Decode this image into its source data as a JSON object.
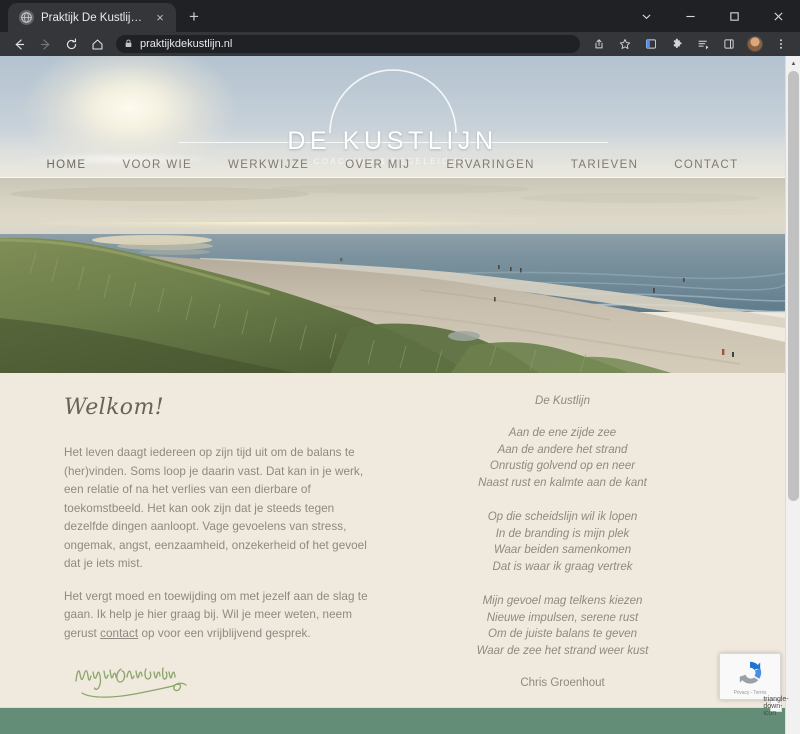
{
  "browser": {
    "tab": {
      "title": "Praktijk De Kustlijn - Home",
      "favicon_icon": "globe-icon",
      "close_icon": "×"
    },
    "new_tab_icon": "+",
    "window_controls": {
      "chevron_icon": "chevron-down-icon",
      "minimize_icon": "minimize-icon",
      "maximize_icon": "maximize-icon",
      "close_icon": "close-icon"
    },
    "toolbar": {
      "back_icon": "back-arrow-icon",
      "forward_icon": "forward-arrow-icon",
      "reload_icon": "reload-icon",
      "home_icon": "home-icon",
      "url": "praktijkdekustlijn.nl",
      "lock_icon": "lock-icon",
      "share_icon": "share-icon",
      "bookmark_icon": "star-icon",
      "sidepanel_icon": "side-panel-icon",
      "extensions_icon": "puzzle-icon",
      "reading_list_icon": "reading-list-icon",
      "split_icon": "split-view-icon",
      "profile_icon": "avatar-icon",
      "menu_icon": "three-dots-menu-icon"
    }
  },
  "site": {
    "logo": {
      "name": "DE KUSTLIJN",
      "subtitle": "COACHING & BEGELEIDING",
      "arc_icon": "arc-icon"
    },
    "nav": [
      {
        "label": "HOME",
        "active": true
      },
      {
        "label": "VOOR WIE",
        "active": false
      },
      {
        "label": "WERKWIJZE",
        "active": false
      },
      {
        "label": "OVER MIJ",
        "active": false
      },
      {
        "label": "ERVARINGEN",
        "active": false
      },
      {
        "label": "TARIEVEN",
        "active": false
      },
      {
        "label": "CONTACT",
        "active": false
      }
    ],
    "hero": {
      "alt": "beach-dunes-sunset-photo"
    },
    "main": {
      "heading": "Welkom!",
      "paragraph_1_before_link": "Het leven daagt iedereen op zijn tijd uit om de balans te (her)vinden. Soms loop je daarin vast. Dat kan in je werk, een relatie of na het verlies van een dierbare of toekomstbeeld. Het kan ook zijn dat je steeds tegen dezelfde dingen aanloopt. Vage gevoelens van stress, ongemak, angst, eenzaamheid, onzekerheid of het gevoel dat je iets mist.",
      "paragraph_2_part1": "Het vergt moed en toewijding om met jezelf aan de slag te gaan. Ik help je hier graag bij. Wil je meer weten, neem gerust ",
      "paragraph_2_link": "contact",
      "paragraph_2_part2": " op voor een vrijblijvend gesprek.",
      "signature_alt": "handwritten-signature-marijn-galema"
    },
    "poem": {
      "title": "De Kustlijn",
      "stanza_1": [
        "Aan de ene zijde zee",
        "Aan de andere het strand",
        "Onrustig golvend op en neer",
        "Naast rust en kalmte aan de kant"
      ],
      "stanza_2": [
        "Op die scheidslijn wil ik lopen",
        "In de branding is mijn plek",
        "Waar beiden samenkomen",
        "Dat is waar ik graag vertrek"
      ],
      "stanza_3": [
        "Mijn gevoel mag telkens kiezen",
        "Nieuwe impulsen, serene rust",
        "Om de juiste balans te geven",
        "Waar de zee het strand weer kust"
      ],
      "author": "Chris Groenhout"
    },
    "recaptcha": {
      "text": "Privacy - Terms",
      "logo_icon": "recaptcha-icon",
      "toggle_icon": "triangle-down-icon"
    }
  },
  "scrollbar": {
    "up_icon": "▲",
    "down_icon": "▼"
  },
  "colors": {
    "page_background": "#f0e9de",
    "footer_band": "#648d77",
    "body_text": "#8d8a81",
    "heading_text": "#6b6256",
    "nav_text": "#7f7b72",
    "signature_green": "#8aa56a",
    "chrome_dark": "#202124",
    "chrome_toolbar": "#35363a"
  }
}
